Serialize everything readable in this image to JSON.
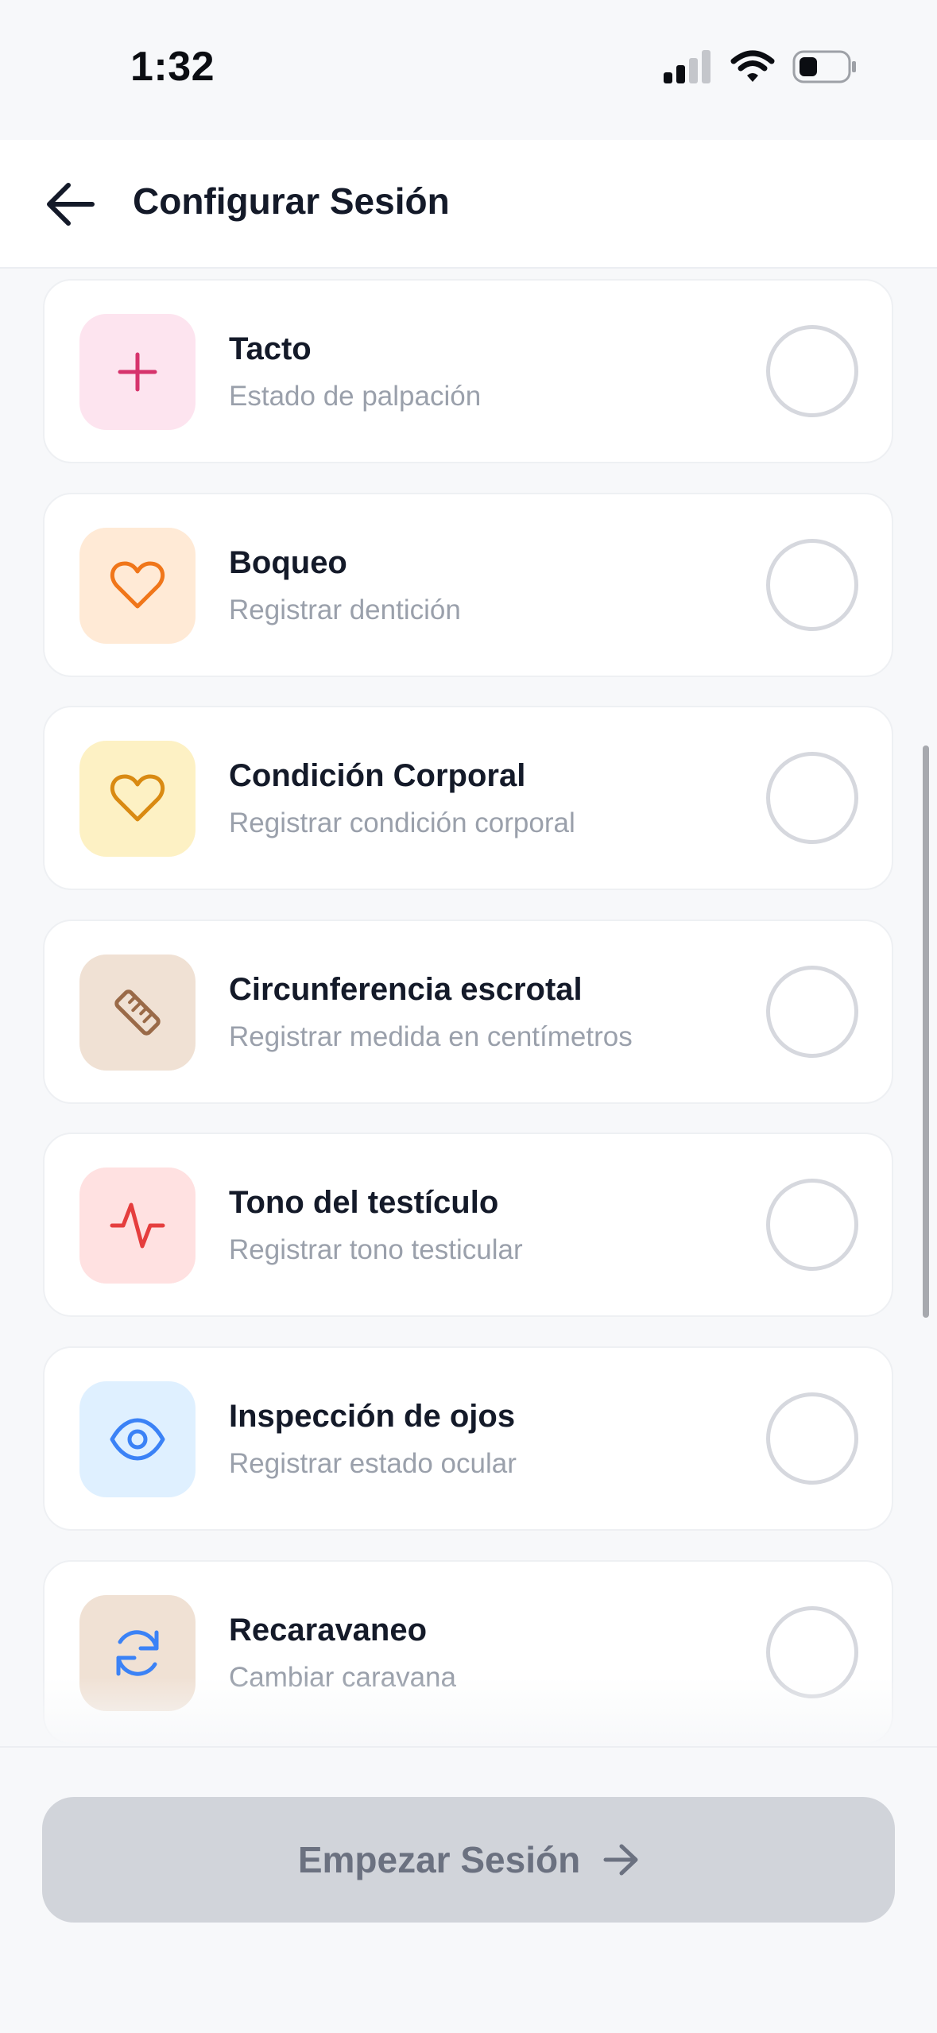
{
  "status_bar": {
    "time": "1:32",
    "icons": [
      "signal-icon",
      "wifi-icon",
      "battery-icon"
    ]
  },
  "header": {
    "title": "Configurar Sesión",
    "back_icon": "arrow-left-icon"
  },
  "options": [
    {
      "title": "Tacto",
      "subtitle": "Estado de palpación",
      "icon": "plus-icon",
      "tile_color": "#fde4ef",
      "icon_color": "#d6336c",
      "selected": false
    },
    {
      "title": "Boqueo",
      "subtitle": "Registrar dentición",
      "icon": "heart-icon",
      "tile_color": "#ffead6",
      "icon_color": "#f0761a",
      "selected": false
    },
    {
      "title": "Condición Corporal",
      "subtitle": "Registrar condición corporal",
      "icon": "heart-icon",
      "tile_color": "#fdf1c4",
      "icon_color": "#d98a12",
      "selected": false
    },
    {
      "title": "Circunferencia escrotal",
      "subtitle": "Registrar medida en centímetros",
      "icon": "ruler-icon",
      "tile_color": "#f0e1d4",
      "icon_color": "#9a6a48",
      "selected": false
    },
    {
      "title": "Tono del testículo",
      "subtitle": "Registrar tono testicular",
      "icon": "pulse-icon",
      "tile_color": "#ffe1e1",
      "icon_color": "#e53e3e",
      "selected": false
    },
    {
      "title": "Inspección de ojos",
      "subtitle": "Registrar estado ocular",
      "icon": "eye-icon",
      "tile_color": "#dff0ff",
      "icon_color": "#3b82f6",
      "selected": false
    },
    {
      "title": "Recaravaneo",
      "subtitle": "Cambiar caravana",
      "icon": "refresh-icon",
      "tile_color": "#f0e1d4",
      "icon_color": "#3b82f6",
      "selected": false
    }
  ],
  "footer": {
    "start_label": "Empezar Sesión",
    "start_icon": "arrow-right-icon",
    "enabled": false
  }
}
